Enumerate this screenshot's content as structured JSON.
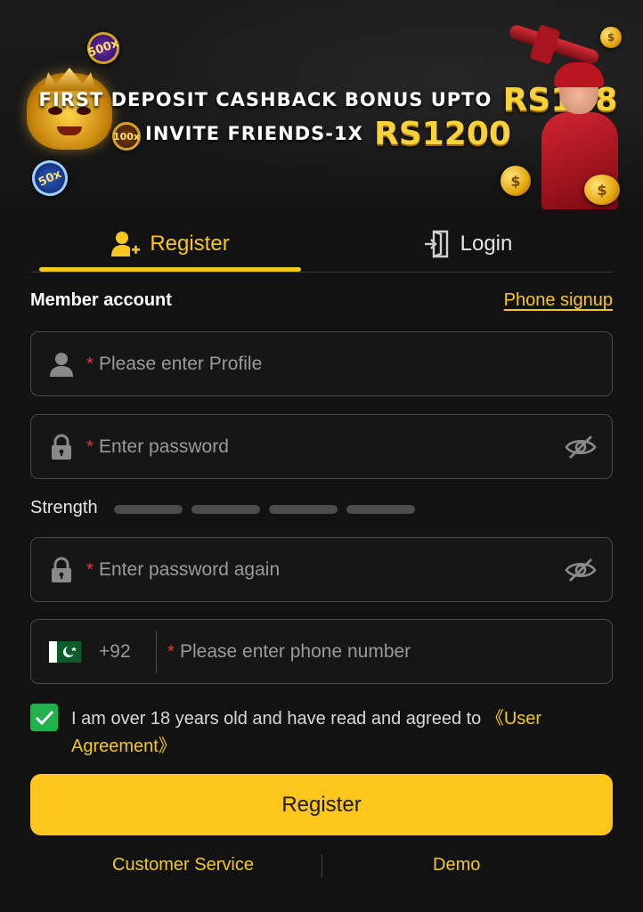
{
  "banner": {
    "line1_text": "FIRST DEPOSIT CASHBACK BONUS UPTO",
    "line1_amount": "RS188",
    "line2_text": "INVITE FRIENDS-1X",
    "line2_amount": "RS1200",
    "chips": [
      "500x",
      "100x",
      "50x"
    ]
  },
  "tabs": {
    "register_label": "Register",
    "login_label": "Login",
    "active": "register"
  },
  "form": {
    "section_title": "Member account",
    "phone_signup_label": "Phone signup",
    "required_mark": "*",
    "profile_placeholder": "Please enter Profile",
    "password_placeholder": "Enter password",
    "strength_label": "Strength",
    "password_again_placeholder": "Enter password again",
    "country_code": "+92",
    "phone_placeholder": "Please enter phone number",
    "agreement_text": "I am over 18 years old and have read and agreed to ",
    "agreement_link": "《User Agreement》",
    "agreement_checked": true,
    "submit_label": "Register"
  },
  "footer": {
    "customer_service_label": "Customer Service",
    "demo_label": "Demo"
  },
  "colors": {
    "accent": "#f6c71f",
    "button": "#fcc71a",
    "background": "#121212",
    "check": "#22b14c",
    "required": "#e23b3b"
  },
  "icons": {
    "register_tab": "user-plus-icon",
    "login_tab": "door-enter-icon",
    "profile": "user-icon",
    "password": "lock-icon",
    "toggle_visibility": "eye-slash-icon",
    "country": "pakistan-flag-icon",
    "checkbox": "checkmark-icon"
  }
}
